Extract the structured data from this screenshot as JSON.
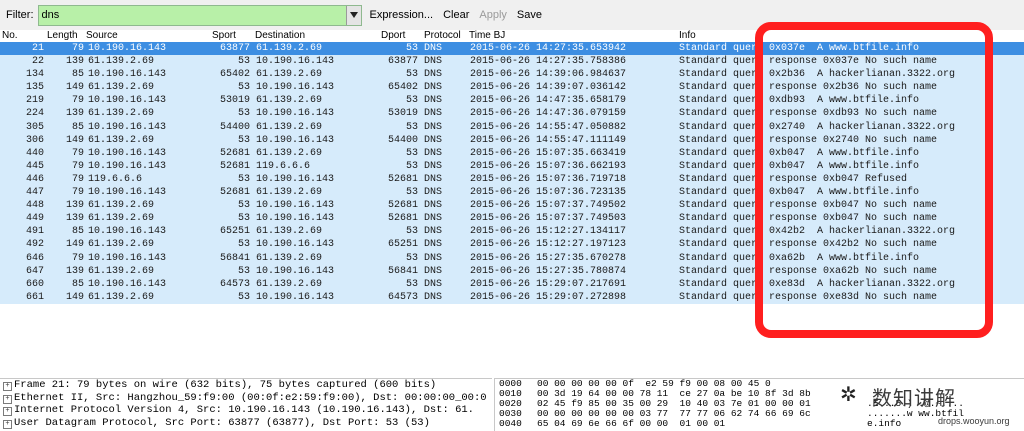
{
  "filter": {
    "label": "Filter:",
    "value": "dns"
  },
  "toolbar": {
    "expression": "Expression...",
    "clear": "Clear",
    "apply": "Apply",
    "save": "Save"
  },
  "columns": {
    "no": "No.",
    "length": "Length",
    "source": "Source",
    "sport": "Sport",
    "destination": "Destination",
    "dport": "Dport",
    "protocol": "Protocol",
    "time": "Time BJ",
    "info": "Info"
  },
  "packets": [
    {
      "no": "21",
      "len": "79",
      "src": "10.190.16.143",
      "sport": "63877",
      "dst": "61.139.2.69",
      "dport": "53",
      "proto": "DNS",
      "time": "2015-06-26 14:27:35.653942",
      "info": "Standard query 0x037e  A www.btfile.info"
    },
    {
      "no": "22",
      "len": "139",
      "src": "61.139.2.69",
      "sport": "53",
      "dst": "10.190.16.143",
      "dport": "63877",
      "proto": "DNS",
      "time": "2015-06-26 14:27:35.758386",
      "info": "Standard query response 0x037e No such name"
    },
    {
      "no": "134",
      "len": "85",
      "src": "10.190.16.143",
      "sport": "65402",
      "dst": "61.139.2.69",
      "dport": "53",
      "proto": "DNS",
      "time": "2015-06-26 14:39:06.984637",
      "info": "Standard query 0x2b36  A hackerlianan.3322.org"
    },
    {
      "no": "135",
      "len": "149",
      "src": "61.139.2.69",
      "sport": "53",
      "dst": "10.190.16.143",
      "dport": "65402",
      "proto": "DNS",
      "time": "2015-06-26 14:39:07.036142",
      "info": "Standard query response 0x2b36 No such name"
    },
    {
      "no": "219",
      "len": "79",
      "src": "10.190.16.143",
      "sport": "53019",
      "dst": "61.139.2.69",
      "dport": "53",
      "proto": "DNS",
      "time": "2015-06-26 14:47:35.658179",
      "info": "Standard query 0xdb93  A www.btfile.info"
    },
    {
      "no": "224",
      "len": "139",
      "src": "61.139.2.69",
      "sport": "53",
      "dst": "10.190.16.143",
      "dport": "53019",
      "proto": "DNS",
      "time": "2015-06-26 14:47:36.079159",
      "info": "Standard query response 0xdb93 No such name"
    },
    {
      "no": "305",
      "len": "85",
      "src": "10.190.16.143",
      "sport": "54400",
      "dst": "61.139.2.69",
      "dport": "53",
      "proto": "DNS",
      "time": "2015-06-26 14:55:47.050882",
      "info": "Standard query 0x2740  A hackerlianan.3322.org"
    },
    {
      "no": "306",
      "len": "149",
      "src": "61.139.2.69",
      "sport": "53",
      "dst": "10.190.16.143",
      "dport": "54400",
      "proto": "DNS",
      "time": "2015-06-26 14:55:47.111149",
      "info": "Standard query response 0x2740 No such name"
    },
    {
      "no": "440",
      "len": "79",
      "src": "10.190.16.143",
      "sport": "52681",
      "dst": "61.139.2.69",
      "dport": "53",
      "proto": "DNS",
      "time": "2015-06-26 15:07:35.663419",
      "info": "Standard query 0xb047  A www.btfile.info"
    },
    {
      "no": "445",
      "len": "79",
      "src": "10.190.16.143",
      "sport": "52681",
      "dst": "119.6.6.6",
      "dport": "53",
      "proto": "DNS",
      "time": "2015-06-26 15:07:36.662193",
      "info": "Standard query 0xb047  A www.btfile.info"
    },
    {
      "no": "446",
      "len": "79",
      "src": "119.6.6.6",
      "sport": "53",
      "dst": "10.190.16.143",
      "dport": "52681",
      "proto": "DNS",
      "time": "2015-06-26 15:07:36.719718",
      "info": "Standard query response 0xb047 Refused"
    },
    {
      "no": "447",
      "len": "79",
      "src": "10.190.16.143",
      "sport": "52681",
      "dst": "61.139.2.69",
      "dport": "53",
      "proto": "DNS",
      "time": "2015-06-26 15:07:36.723135",
      "info": "Standard query 0xb047  A www.btfile.info"
    },
    {
      "no": "448",
      "len": "139",
      "src": "61.139.2.69",
      "sport": "53",
      "dst": "10.190.16.143",
      "dport": "52681",
      "proto": "DNS",
      "time": "2015-06-26 15:07:37.749502",
      "info": "Standard query response 0xb047 No such name"
    },
    {
      "no": "449",
      "len": "139",
      "src": "61.139.2.69",
      "sport": "53",
      "dst": "10.190.16.143",
      "dport": "52681",
      "proto": "DNS",
      "time": "2015-06-26 15:07:37.749503",
      "info": "Standard query response 0xb047 No such name"
    },
    {
      "no": "491",
      "len": "85",
      "src": "10.190.16.143",
      "sport": "65251",
      "dst": "61.139.2.69",
      "dport": "53",
      "proto": "DNS",
      "time": "2015-06-26 15:12:27.134117",
      "info": "Standard query 0x42b2  A hackerlianan.3322.org"
    },
    {
      "no": "492",
      "len": "149",
      "src": "61.139.2.69",
      "sport": "53",
      "dst": "10.190.16.143",
      "dport": "65251",
      "proto": "DNS",
      "time": "2015-06-26 15:12:27.197123",
      "info": "Standard query response 0x42b2 No such name"
    },
    {
      "no": "646",
      "len": "79",
      "src": "10.190.16.143",
      "sport": "56841",
      "dst": "61.139.2.69",
      "dport": "53",
      "proto": "DNS",
      "time": "2015-06-26 15:27:35.670278",
      "info": "Standard query 0xa62b  A www.btfile.info"
    },
    {
      "no": "647",
      "len": "139",
      "src": "61.139.2.69",
      "sport": "53",
      "dst": "10.190.16.143",
      "dport": "56841",
      "proto": "DNS",
      "time": "2015-06-26 15:27:35.780874",
      "info": "Standard query response 0xa62b No such name"
    },
    {
      "no": "660",
      "len": "85",
      "src": "10.190.16.143",
      "sport": "64573",
      "dst": "61.139.2.69",
      "dport": "53",
      "proto": "DNS",
      "time": "2015-06-26 15:29:07.217691",
      "info": "Standard query 0xe83d  A hackerlianan.3322.org"
    },
    {
      "no": "661",
      "len": "149",
      "src": "61.139.2.69",
      "sport": "53",
      "dst": "10.190.16.143",
      "dport": "64573",
      "proto": "DNS",
      "time": "2015-06-26 15:29:07.272898",
      "info": "Standard query response 0xe83d No such name"
    }
  ],
  "details": [
    "Frame 21: 79 bytes on wire (632 bits), 75 bytes captured (600 bits)",
    "Ethernet II, Src: Hangzhou_59:f9:00 (00:0f:e2:59:f9:00), Dst: 00:00:00_00:0",
    "Internet Protocol Version 4, Src: 10.190.16.143 (10.190.16.143), Dst: 61.",
    "User Datagram Protocol, Src Port: 63877 (63877), Dst Port: 53 (53)"
  ],
  "hex": [
    {
      "offset": "0000",
      "bytes": "00 00 00 00 00 0f  e2 59 f9 00 08 00 45 0",
      "ascii": ""
    },
    {
      "offset": "0010",
      "bytes": "00 3d 19 64 00 00 78 11  ce 27 0a be 10 8f 3d 8b",
      "ascii": ""
    },
    {
      "offset": "0020",
      "bytes": "02 45 f9 85 00 35 00 29  10 40 03 7e 01 00 00 01",
      "ascii": ".E...5.) .@.~...."
    },
    {
      "offset": "0030",
      "bytes": "00 00 00 00 00 00 03 77  77 77 06 62 74 66 69 6c",
      "ascii": ".......w ww.btfil"
    },
    {
      "offset": "0040",
      "bytes": "65 04 69 6e 66 6f 00 00  01 00 01",
      "ascii": "e.info"
    }
  ],
  "watermark": {
    "text": "数知讲解",
    "url": "drops.wooyun.org"
  },
  "colors": {
    "selected_row": "#3d8ee2",
    "row_bg": "#d6ebfb",
    "filter_bg": "#b8f0a8",
    "highlight": "#ff1f1f"
  }
}
